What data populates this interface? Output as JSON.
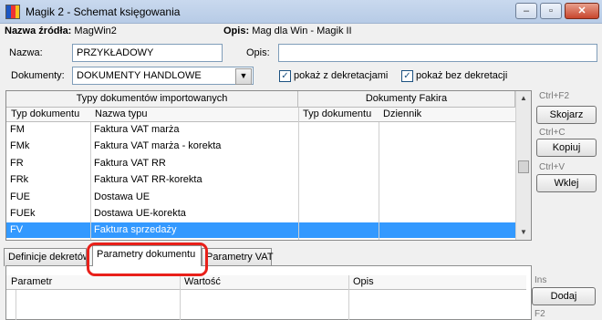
{
  "window": {
    "title": "Magik 2 - Schemat księgowania",
    "controls": {
      "minimize": "–",
      "maximize": "▫",
      "close": "✕"
    }
  },
  "source": {
    "name_label": "Nazwa źródła:",
    "name_value": "MagWin2",
    "desc_label": "Opis:",
    "desc_value": "Mag dla Win - Magik II"
  },
  "form": {
    "nazwa_label": "Nazwa:",
    "nazwa_value": "PRZYKŁADOWY",
    "opis_label": "Opis:",
    "opis_value": "",
    "dokumenty_label": "Dokumenty:",
    "dokumenty_value": "DOKUMENTY HANDLOWE",
    "show_with_label": "pokaż z dekretacjami",
    "show_without_label": "pokaż bez dekretacji",
    "show_with_checked": true,
    "show_without_checked": true
  },
  "grid": {
    "group1": "Typy dokumentów importowanych",
    "group2": "Dokumenty Fakira",
    "columns": [
      "Typ dokumentu",
      "Nazwa typu",
      "Typ dokumentu",
      "Dziennik"
    ],
    "rows": [
      {
        "typ": "FM",
        "nazwa": "Faktura VAT marża"
      },
      {
        "typ": "FMk",
        "nazwa": "Faktura VAT marża - korekta"
      },
      {
        "typ": "FR",
        "nazwa": "Faktura VAT RR"
      },
      {
        "typ": "FRk",
        "nazwa": "Faktura VAT RR-korekta"
      },
      {
        "typ": "FUE",
        "nazwa": "Dostawa UE"
      },
      {
        "typ": "FUEk",
        "nazwa": "Dostawa UE-korekta"
      },
      {
        "typ": "FV",
        "nazwa": "Faktura sprzedaży"
      }
    ],
    "selected_index": 6
  },
  "side_actions": [
    {
      "shortcut": "Ctrl+F2",
      "label": "Skojarz"
    },
    {
      "shortcut": "Ctrl+C",
      "label": "Kopiuj"
    },
    {
      "shortcut": "Ctrl+V",
      "label": "Wklej"
    }
  ],
  "tabs": [
    "Definicje dekretów",
    "Parametry dokumentu",
    "Parametry VAT"
  ],
  "active_tab": "Parametry dokumentu",
  "params_table": {
    "columns": [
      "Parametr",
      "Wartość",
      "Opis"
    ]
  },
  "bottom_actions": [
    {
      "shortcut": "Ins",
      "label": "Dodaj"
    },
    {
      "shortcut": "F2",
      "label": ""
    }
  ],
  "colors": {
    "selection": "#3399ff",
    "highlight": "#e8201a"
  }
}
